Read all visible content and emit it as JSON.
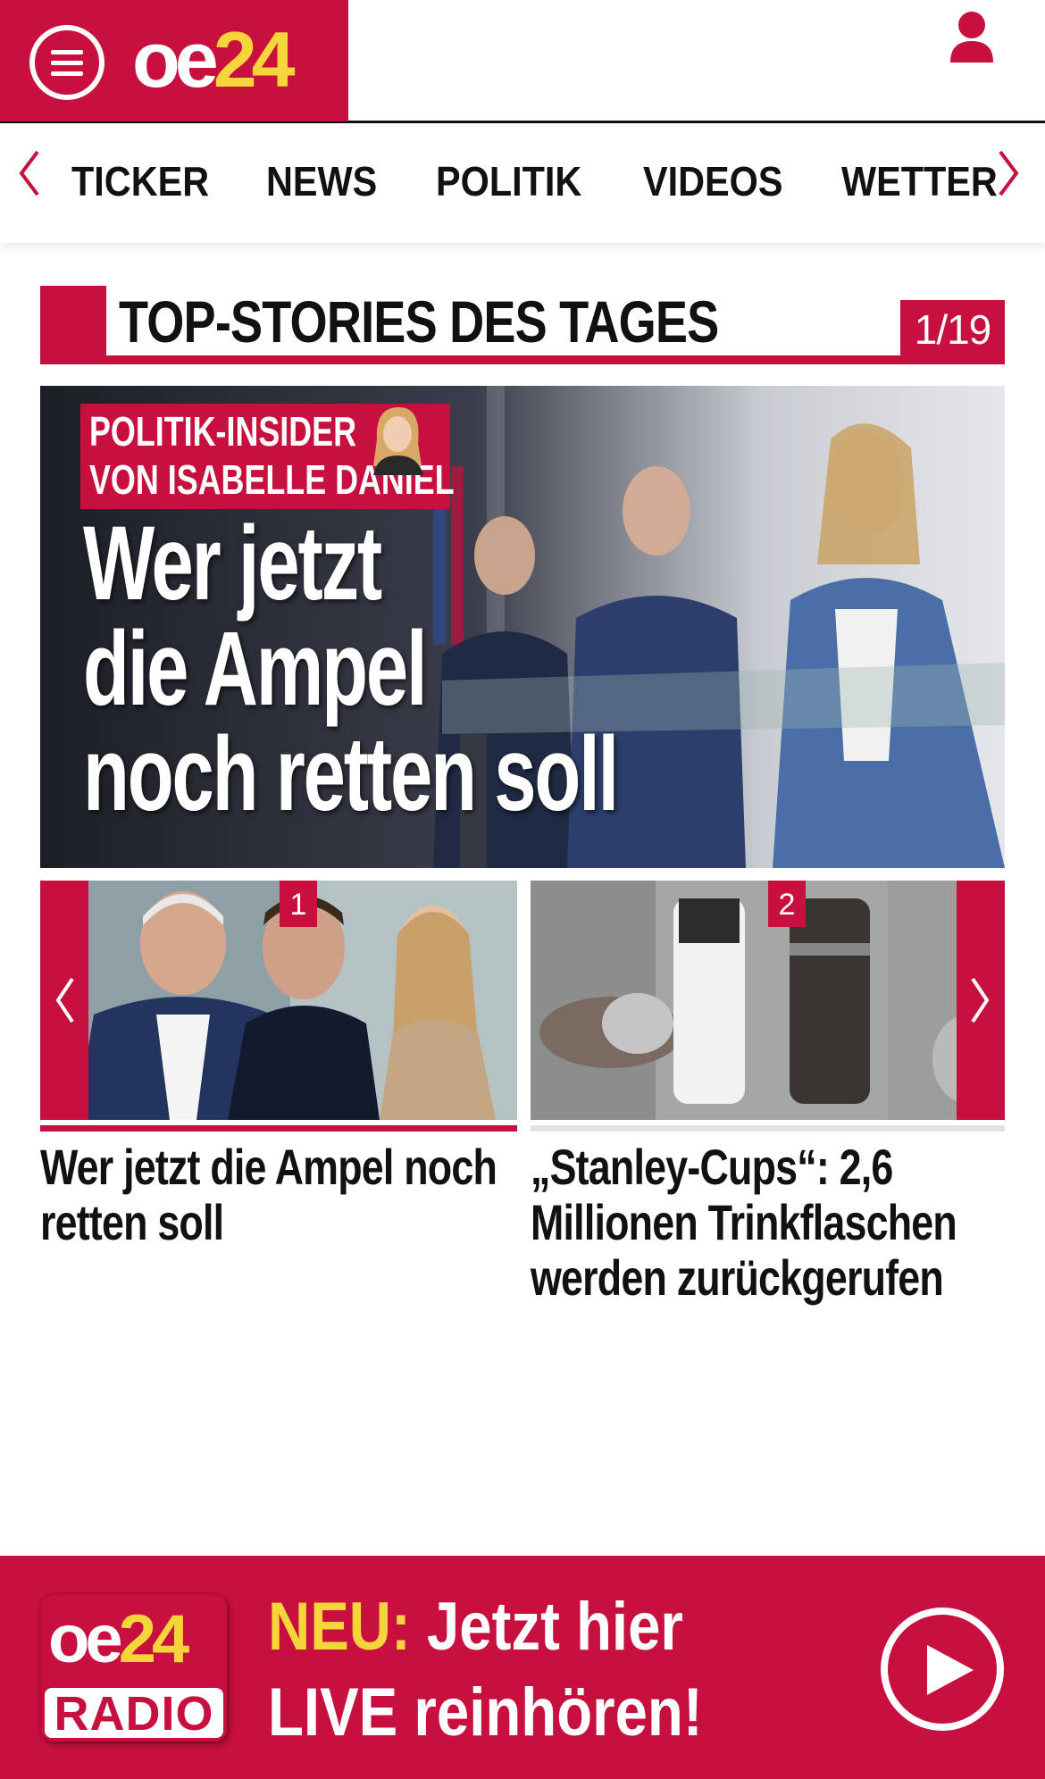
{
  "header": {
    "logo_oe": "oe",
    "logo_24": "24"
  },
  "nav": {
    "items": [
      "TICKER",
      "NEWS",
      "POLITIK",
      "VIDEOS",
      "WETTER"
    ]
  },
  "section": {
    "title": "TOP-STORIES DES TAGES",
    "counter": "1/19"
  },
  "hero": {
    "kicker_line1": "POLITIK-INSIDER",
    "kicker_line2": "VON ISABELLE DANIEL",
    "headline_line1": "Wer jetzt",
    "headline_line2": "die Ampel",
    "headline_line3": "noch retten soll"
  },
  "cards": [
    {
      "number": "1",
      "title_line1": "Wer jetzt die Ampel noch",
      "title_line2": "retten soll"
    },
    {
      "number": "2",
      "title_line1": "„Stanley-Cups“: 2,6",
      "title_line2": "Millionen Trinkflaschen",
      "title_line3": "werden zurückgerufen"
    }
  ],
  "banner": {
    "logo_oe": "oe",
    "logo_24": "24",
    "logo_radio": "RADIO",
    "neu": "NEU:",
    "text_line1": " Jetzt hier",
    "text_line2": "LIVE reinhören!"
  },
  "colors": {
    "brand_red": "#c8103e",
    "brand_yellow": "#f6d53b"
  },
  "icons": [
    "menu-icon",
    "user-icon",
    "chevron-left-icon",
    "chevron-right-icon",
    "play-icon"
  ]
}
